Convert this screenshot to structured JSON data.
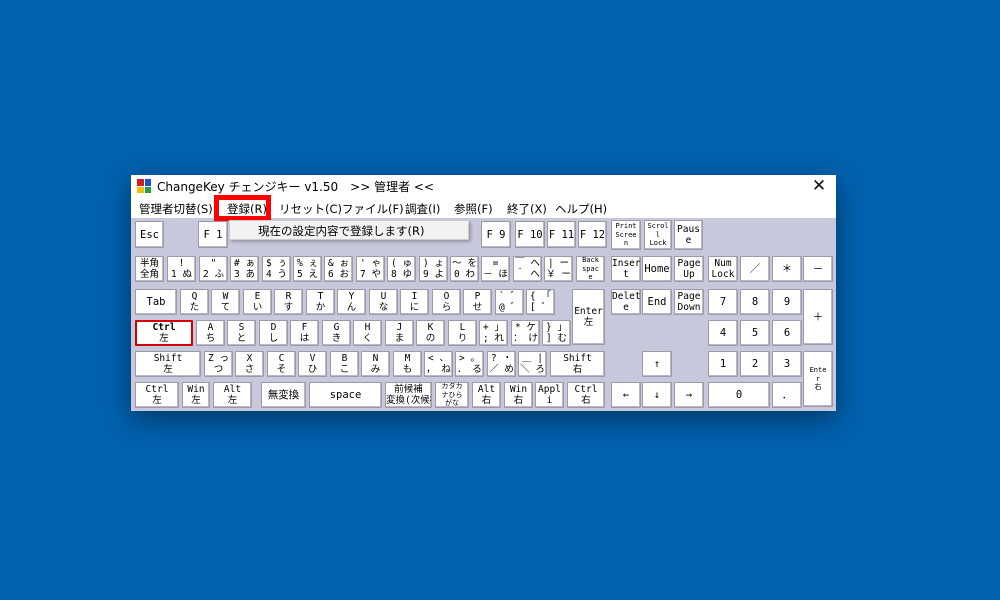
{
  "window": {
    "title": "ChangeKey チェンジキー v1.50　>> 管理者 <<",
    "close_glyph": "✕"
  },
  "colors": {
    "desktop": "#0062b0",
    "keyboard_bg": "#c8c8dc",
    "highlight": "#ff0000"
  },
  "menu": {
    "items": [
      "管理者切替(S)",
      "登録(R)",
      "リセット(C)",
      "ファイル(F)",
      "調査(I)",
      "参照(F)",
      "終了(X)",
      "ヘルプ(H)"
    ],
    "dropdown_item": "現在の設定内容で登録します(R)"
  },
  "keys": [
    {
      "name": "esc",
      "lines": [
        "Esc"
      ]
    },
    {
      "name": "f1",
      "lines": [
        "F 1"
      ]
    },
    {
      "name": "f9",
      "lines": [
        "F 9"
      ]
    },
    {
      "name": "f10",
      "lines": [
        "F 10"
      ]
    },
    {
      "name": "f11",
      "lines": [
        "F 11"
      ]
    },
    {
      "name": "f12",
      "lines": [
        "F 12"
      ]
    },
    {
      "name": "print-screen",
      "lines": [
        "Print",
        "Scree",
        "n"
      ]
    },
    {
      "name": "scroll-lock",
      "lines": [
        "Scrol",
        "l",
        "Lock"
      ]
    },
    {
      "name": "pause",
      "lines": [
        "Paus",
        "e"
      ]
    },
    {
      "name": "hankaku",
      "lines": [
        "半角",
        "全角"
      ]
    },
    {
      "name": "1",
      "lines": [
        "!",
        "1 ぬ"
      ]
    },
    {
      "name": "2",
      "lines": [
        "\"",
        "2 ふ"
      ]
    },
    {
      "name": "3",
      "lines": [
        "# ぁ",
        "3 あ"
      ]
    },
    {
      "name": "4",
      "lines": [
        "$ ぅ",
        "4 う"
      ]
    },
    {
      "name": "5",
      "lines": [
        "% ぇ",
        "5 え"
      ]
    },
    {
      "name": "6",
      "lines": [
        "& ぉ",
        "6 お"
      ]
    },
    {
      "name": "7",
      "lines": [
        "' ゃ",
        "7 や"
      ]
    },
    {
      "name": "8",
      "lines": [
        "( ゅ",
        "8 ゆ"
      ]
    },
    {
      "name": "9",
      "lines": [
        ") ょ",
        "9 よ"
      ]
    },
    {
      "name": "0",
      "lines": [
        "～ を",
        "0 わ"
      ]
    },
    {
      "name": "minus",
      "lines": [
        "=",
        "－ ほ"
      ]
    },
    {
      "name": "caret",
      "lines": [
        "￣ へ",
        "＾ へ"
      ]
    },
    {
      "name": "yen",
      "lines": [
        "| ー",
        "￥ ー"
      ]
    },
    {
      "name": "backspace",
      "lines": [
        "Back",
        "spac",
        "e"
      ]
    },
    {
      "name": "insert",
      "lines": [
        "Inser",
        "t"
      ]
    },
    {
      "name": "home",
      "lines": [
        "Home"
      ]
    },
    {
      "name": "page-up",
      "lines": [
        "Page",
        "Up"
      ]
    },
    {
      "name": "num-lock",
      "lines": [
        "Num",
        "Lock"
      ]
    },
    {
      "name": "num-slash",
      "lines": [
        "／"
      ]
    },
    {
      "name": "num-star",
      "lines": [
        "＊"
      ]
    },
    {
      "name": "num-minus",
      "lines": [
        "－"
      ]
    },
    {
      "name": "tab",
      "lines": [
        "Tab"
      ]
    },
    {
      "name": "q",
      "lines": [
        "Q",
        "た"
      ]
    },
    {
      "name": "w",
      "lines": [
        "W",
        "て"
      ]
    },
    {
      "name": "e",
      "lines": [
        "E",
        "い"
      ]
    },
    {
      "name": "r",
      "lines": [
        "R",
        "す"
      ]
    },
    {
      "name": "t",
      "lines": [
        "T",
        "か"
      ]
    },
    {
      "name": "y",
      "lines": [
        "Y",
        "ん"
      ]
    },
    {
      "name": "u",
      "lines": [
        "U",
        "な"
      ]
    },
    {
      "name": "i",
      "lines": [
        "I",
        "に"
      ]
    },
    {
      "name": "o",
      "lines": [
        "O",
        "ら"
      ]
    },
    {
      "name": "p",
      "lines": [
        "P",
        "せ"
      ]
    },
    {
      "name": "at",
      "lines": [
        "` ゛",
        "@ ゛"
      ]
    },
    {
      "name": "bracket-open",
      "lines": [
        "{ 「",
        "[ ゜"
      ]
    },
    {
      "name": "enter",
      "lines": [
        "Enter",
        "左"
      ]
    },
    {
      "name": "delete",
      "lines": [
        "Delet",
        "e"
      ]
    },
    {
      "name": "end",
      "lines": [
        "End"
      ]
    },
    {
      "name": "page-down",
      "lines": [
        "Page",
        "Down"
      ]
    },
    {
      "name": "num7",
      "lines": [
        "7"
      ]
    },
    {
      "name": "num8",
      "lines": [
        "8"
      ]
    },
    {
      "name": "num9",
      "lines": [
        "9"
      ]
    },
    {
      "name": "num-plus",
      "lines": [
        "＋"
      ]
    },
    {
      "name": "ctrl-left",
      "lines": [
        "Ctrl",
        "左"
      ]
    },
    {
      "name": "a",
      "lines": [
        "A",
        "ち"
      ]
    },
    {
      "name": "s",
      "lines": [
        "S",
        "と"
      ]
    },
    {
      "name": "d",
      "lines": [
        "D",
        "し"
      ]
    },
    {
      "name": "f",
      "lines": [
        "F",
        "は"
      ]
    },
    {
      "name": "g",
      "lines": [
        "G",
        "き"
      ]
    },
    {
      "name": "h",
      "lines": [
        "H",
        "く"
      ]
    },
    {
      "name": "j",
      "lines": [
        "J",
        "ま"
      ]
    },
    {
      "name": "k",
      "lines": [
        "K",
        "の"
      ]
    },
    {
      "name": "l",
      "lines": [
        "L",
        "り"
      ]
    },
    {
      "name": "semicolon",
      "lines": [
        "+ 」",
        "; れ"
      ]
    },
    {
      "name": "colon",
      "lines": [
        "* ケ",
        "： け"
      ]
    },
    {
      "name": "bracket-close",
      "lines": [
        "} 」",
        "] む"
      ]
    },
    {
      "name": "num4",
      "lines": [
        "4"
      ]
    },
    {
      "name": "num5",
      "lines": [
        "5"
      ]
    },
    {
      "name": "num6",
      "lines": [
        "6"
      ]
    },
    {
      "name": "shift-left",
      "lines": [
        "Shift",
        "左"
      ]
    },
    {
      "name": "z",
      "lines": [
        "Z っ",
        "つ"
      ]
    },
    {
      "name": "x",
      "lines": [
        "X",
        "さ"
      ]
    },
    {
      "name": "c",
      "lines": [
        "C",
        "そ"
      ]
    },
    {
      "name": "v",
      "lines": [
        "V",
        "ひ"
      ]
    },
    {
      "name": "b",
      "lines": [
        "B",
        "こ"
      ]
    },
    {
      "name": "n",
      "lines": [
        "N",
        "み"
      ]
    },
    {
      "name": "m",
      "lines": [
        "M",
        "も"
      ]
    },
    {
      "name": "comma",
      "lines": [
        "< 、",
        "， ね"
      ]
    },
    {
      "name": "period",
      "lines": [
        "> 。",
        "． る"
      ]
    },
    {
      "name": "slash",
      "lines": [
        "? ・",
        "／ め"
      ]
    },
    {
      "name": "backslash",
      "lines": [
        "＿ |",
        "＼ ろ"
      ]
    },
    {
      "name": "shift-right",
      "lines": [
        "Shift",
        "右"
      ]
    },
    {
      "name": "arrow-up",
      "lines": [
        "↑"
      ]
    },
    {
      "name": "num1",
      "lines": [
        "1"
      ]
    },
    {
      "name": "num2",
      "lines": [
        "2"
      ]
    },
    {
      "name": "num3",
      "lines": [
        "3"
      ]
    },
    {
      "name": "num-enter",
      "lines": [
        "Ente",
        "r",
        "右"
      ]
    },
    {
      "name": "ctrl-left-2",
      "lines": [
        "Ctrl",
        "左"
      ]
    },
    {
      "name": "win-left",
      "lines": [
        "Win",
        "左"
      ]
    },
    {
      "name": "alt-left",
      "lines": [
        "Alt",
        "左"
      ]
    },
    {
      "name": "muhenkan",
      "lines": [
        "無変換"
      ]
    },
    {
      "name": "space",
      "lines": [
        "space"
      ]
    },
    {
      "name": "henkan",
      "lines": [
        "前候補",
        "変換(次候補)"
      ]
    },
    {
      "name": "kana",
      "lines": [
        "カタカ",
        "ナひら",
        "がな"
      ]
    },
    {
      "name": "alt-right",
      "lines": [
        "Alt",
        "右"
      ]
    },
    {
      "name": "win-right",
      "lines": [
        "Win",
        "右"
      ]
    },
    {
      "name": "apps",
      "lines": [
        "Appl",
        "i"
      ]
    },
    {
      "name": "ctrl-right",
      "lines": [
        "Ctrl",
        "右"
      ]
    },
    {
      "name": "arrow-left",
      "lines": [
        "←"
      ]
    },
    {
      "name": "arrow-down",
      "lines": [
        "↓"
      ]
    },
    {
      "name": "arrow-right",
      "lines": [
        "→"
      ]
    },
    {
      "name": "num0",
      "lines": [
        "0"
      ]
    },
    {
      "name": "num-period",
      "lines": [
        "．"
      ]
    }
  ]
}
